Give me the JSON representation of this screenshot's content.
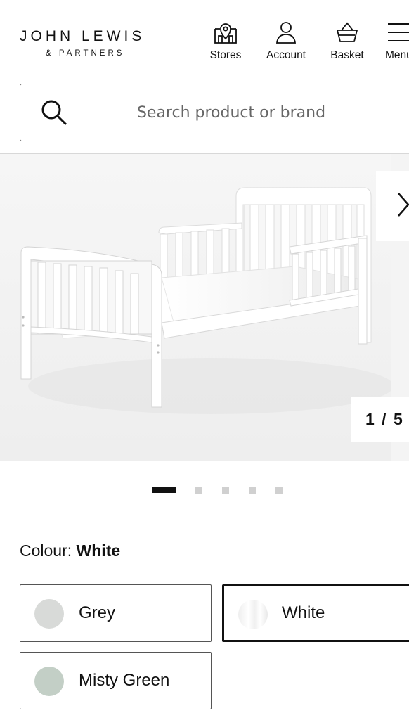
{
  "header": {
    "logo_main": "JOHN LEWIS",
    "logo_sub": "& PARTNERS",
    "nav": [
      {
        "label": "Stores",
        "icon": "store-icon"
      },
      {
        "label": "Account",
        "icon": "account-icon"
      },
      {
        "label": "Basket",
        "icon": "basket-icon"
      },
      {
        "label": "Menu",
        "icon": "menu-icon"
      }
    ]
  },
  "search": {
    "placeholder": "Search product or brand",
    "value": ""
  },
  "gallery": {
    "counter": "1 / 5",
    "current": 1,
    "total": 5,
    "image": "white toddler bed"
  },
  "colour": {
    "label": "Colour:",
    "selected": "White",
    "options": [
      {
        "name": "Grey",
        "swatch": "#d8dad8",
        "selected": false
      },
      {
        "name": "White",
        "swatch": "#f8f8f8",
        "selected": true
      },
      {
        "name": "Misty Green",
        "swatch": "#c3cfc6",
        "selected": false
      }
    ]
  },
  "colors": {
    "accent": "#111111",
    "border": "#333333",
    "gallery_bg": "#f4f4f4"
  }
}
